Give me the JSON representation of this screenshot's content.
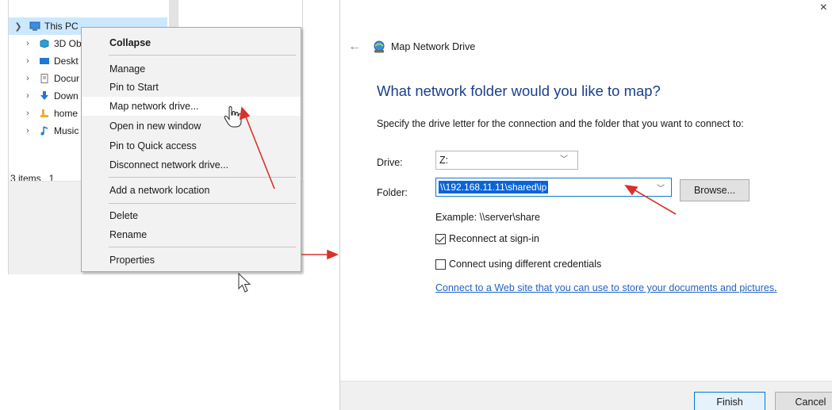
{
  "explorer": {
    "tree": [
      {
        "label": "This PC",
        "expanded": true,
        "selected": true,
        "icon": "computer-icon"
      },
      {
        "label": "3D Ob",
        "icon": "3d-objects-icon"
      },
      {
        "label": "Deskt",
        "icon": "desktop-icon"
      },
      {
        "label": "Docur",
        "icon": "documents-icon"
      },
      {
        "label": "Down",
        "icon": "downloads-icon"
      },
      {
        "label": "home",
        "icon": "folder-icon"
      },
      {
        "label": "Music",
        "icon": "music-icon"
      }
    ],
    "status": "3 items   1"
  },
  "context_menu": {
    "collapse": "Collapse",
    "manage": "Manage",
    "pin_to_start": "Pin to Start",
    "map_network_drive": "Map network drive...",
    "open_new_window": "Open in new window",
    "pin_quick_access": "Pin to Quick access",
    "disconnect": "Disconnect network drive...",
    "add_network_location": "Add a network location",
    "delete": "Delete",
    "rename": "Rename",
    "properties": "Properties"
  },
  "wizard": {
    "title": "Map Network Drive",
    "heading": "What network folder would you like to map?",
    "instruction": "Specify the drive letter for the connection and the folder that you want to connect to:",
    "drive_label": "Drive:",
    "drive_value": "Z:",
    "folder_label": "Folder:",
    "folder_value": "\\\\192.168.11.11\\shared\\ip",
    "browse_label": "Browse...",
    "example": "Example: \\\\server\\share",
    "reconnect_label": "Reconnect at sign-in",
    "reconnect_checked": true,
    "creds_label": "Connect using different credentials",
    "creds_checked": false,
    "web_link": "Connect to a Web site that you can use to store your documents and pictures",
    "web_link_suffix": ".",
    "finish_label": "Finish",
    "cancel_label": "Cancel",
    "close_glyph": "×",
    "back_glyph": "←"
  },
  "colors": {
    "accent": "#0078d7",
    "heading": "#1b3f8a",
    "link": "#1f63c6",
    "selection": "#0a64d6",
    "annotation_arrow": "#d9302a"
  }
}
